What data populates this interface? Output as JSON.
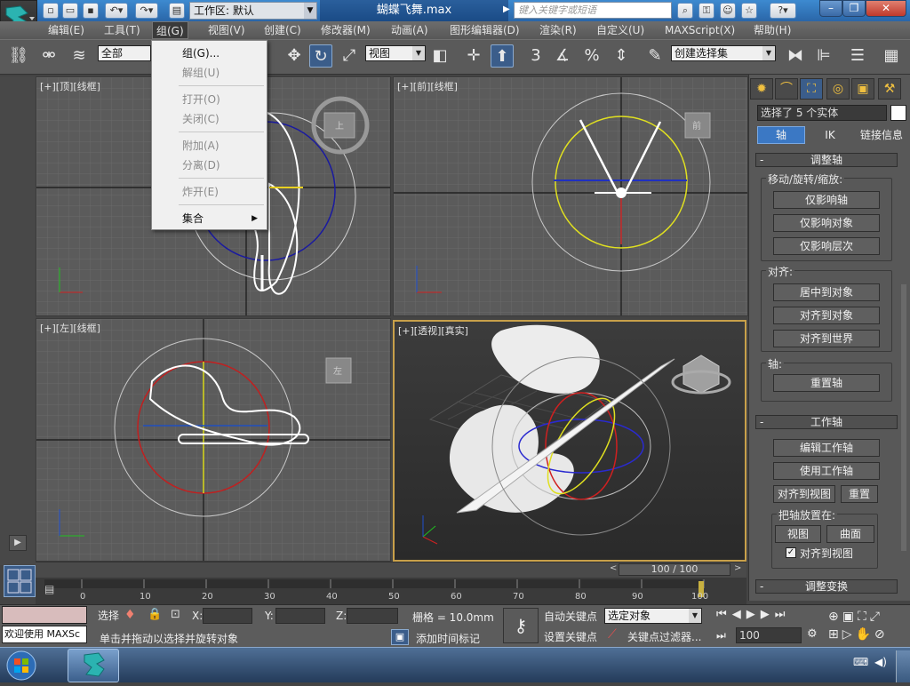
{
  "title_bar": {
    "workspace_label": "工作区: 默认",
    "document_title": "蝴蝶飞舞.max",
    "search_placeholder": "键入关键字或短语"
  },
  "menu": {
    "items": [
      "编辑(E)",
      "工具(T)",
      "组(G)",
      "视图(V)",
      "创建(C)",
      "修改器(M)",
      "动画(A)",
      "图形编辑器(D)",
      "渲染(R)",
      "自定义(U)",
      "MAXScript(X)",
      "帮助(H)"
    ],
    "open_menu": "组(G)"
  },
  "group_menu": {
    "items": [
      {
        "label": "组(G)...",
        "enabled": true
      },
      {
        "label": "解组(U)",
        "enabled": false
      },
      {
        "label": "打开(O)",
        "enabled": false
      },
      {
        "label": "关闭(C)",
        "enabled": false
      },
      {
        "label": "附加(A)",
        "enabled": false
      },
      {
        "label": "分离(D)",
        "enabled": false
      },
      {
        "label": "炸开(E)",
        "enabled": false
      },
      {
        "label": "集合",
        "enabled": true,
        "submenu": true
      }
    ]
  },
  "toolbar": {
    "selection_filter": "全部",
    "ref_coord": "视图",
    "named_selection": "创建选择集",
    "snap_label": "3"
  },
  "viewports": {
    "top": "[+][顶][线框]",
    "front": "[+][前][线框]",
    "left": "[+][左][线框]",
    "perspective": "[+][透视][真实]",
    "cube_top": "上",
    "cube_front": "前",
    "cube_left": "左"
  },
  "command_panel": {
    "selection_info": "选择了 5 个实体",
    "tabs": [
      "轴",
      "IK",
      "链接信息"
    ],
    "adjust_pivot": {
      "title": "调整轴",
      "move_group": "移动/旋转/缩放:",
      "buttons": [
        "仅影响轴",
        "仅影响对象",
        "仅影响层次"
      ],
      "align_group": "对齐:",
      "align_buttons": [
        "居中到对象",
        "对齐到对象",
        "对齐到世界"
      ],
      "pivot_group": "轴:",
      "reset_button": "重置轴"
    },
    "working_pivot": {
      "title": "工作轴",
      "edit_button": "编辑工作轴",
      "use_button": "使用工作轴",
      "align_view_button": "对齐到视图",
      "reset_button": "重置",
      "place_group": "把轴放置在:",
      "view_button": "视图",
      "surface_button": "曲面",
      "align_checkbox": "对齐到视图",
      "align_checked": true
    },
    "adjust_transform_title": "调整变换"
  },
  "timeline": {
    "frame_display": "100 / 100",
    "ticks": [
      "0",
      "10",
      "20",
      "30",
      "40",
      "50",
      "60",
      "70",
      "80",
      "90",
      "100"
    ]
  },
  "status": {
    "welcome": "欢迎使用 MAXSc",
    "select_label": "选择",
    "x_label": "X:",
    "y_label": "Y:",
    "z_label": "Z:",
    "grid": "栅格 = 10.0mm",
    "prompt": "单击并拖动以选择并旋转对象",
    "add_time_tag": "添加时间标记",
    "auto_key": "自动关键点",
    "set_key": "设置关键点",
    "key_mode": "选定对象",
    "key_filters": "关键点过滤器...",
    "frame": "100"
  },
  "colors": {
    "accent": "#3b5d8a",
    "titlebar": "#2a66a8",
    "active_viewport_border": "#c8a04a"
  }
}
